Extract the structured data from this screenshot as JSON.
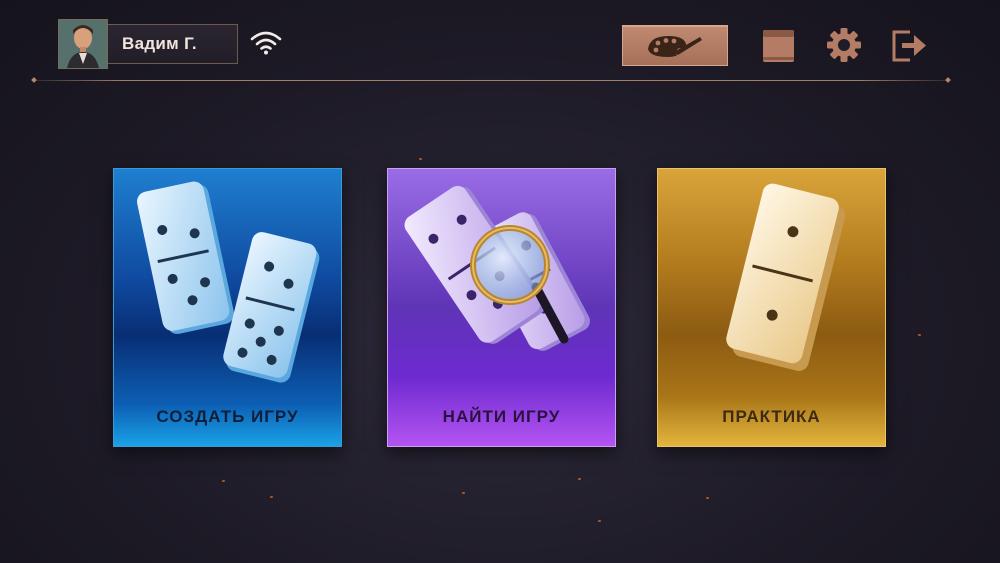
{
  "profile": {
    "name": "Вадим Г.",
    "avatar_icon": "avatar-portrait-icon"
  },
  "status": {
    "connection_icon": "wifi-icon"
  },
  "toolbar": {
    "theme_icon": "palette-icon",
    "book_icon": "book-icon",
    "settings_icon": "gear-icon",
    "exit_icon": "exit-icon",
    "accent": "#b47c64"
  },
  "menu": {
    "cards": [
      {
        "label": "СОЗДАТЬ ИГРУ",
        "icon": "domino-tiles-icon",
        "color": "#1a6cc4"
      },
      {
        "label": "НАЙТИ ИГРУ",
        "icon": "domino-magnifier-icon",
        "color": "#7a3ed8"
      },
      {
        "label": "ПРАКТИКА",
        "icon": "single-domino-icon",
        "color": "#c08a24"
      }
    ]
  }
}
